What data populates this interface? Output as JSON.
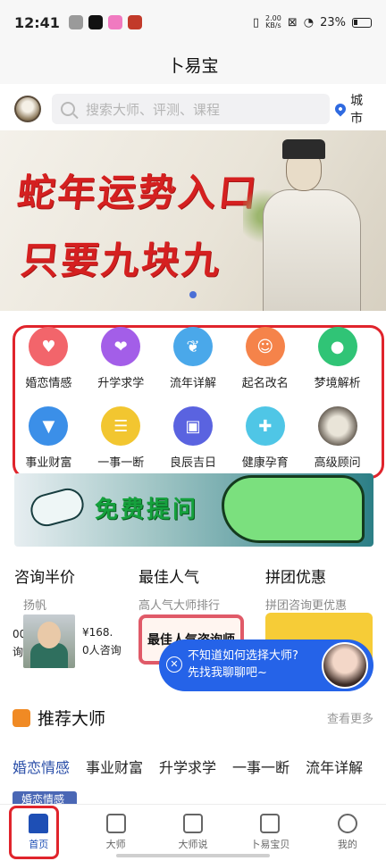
{
  "status": {
    "time": "12:41",
    "speed_top": "2.00",
    "speed_bottom": "KB/s",
    "battery": "23%"
  },
  "app_title": "卜易宝",
  "search": {
    "placeholder": "搜索大师、评测、课程",
    "city": "城市"
  },
  "banner": {
    "line1": "蛇年运势入口",
    "line2": "只要九块九"
  },
  "categories": [
    {
      "label": "婚恋情感",
      "icon": "couple-icon",
      "color": "#f2656b"
    },
    {
      "label": "升学求学",
      "icon": "heart-book-icon",
      "color": "#a35ee8"
    },
    {
      "label": "流年详解",
      "icon": "leaf-icon",
      "color": "#4aa8ea"
    },
    {
      "label": "起名改名",
      "icon": "family-icon",
      "color": "#f5834a"
    },
    {
      "label": "梦境解析",
      "icon": "person-icon",
      "color": "#30c476"
    },
    {
      "label": "事业财富",
      "icon": "tie-icon",
      "color": "#3b8fe8"
    },
    {
      "label": "一事一断",
      "icon": "chat-icon",
      "color": "#f2c630"
    },
    {
      "label": "良辰吉日",
      "icon": "calendar-icon",
      "color": "#5a63e0"
    },
    {
      "label": "健康孕育",
      "icon": "health-heart-icon",
      "color": "#4fc6e6"
    },
    {
      "label": "高级顾问",
      "icon": "advisor-avatar-icon",
      "color": "#8e8679"
    }
  ],
  "free_ask": {
    "text": "免费提问"
  },
  "sections": {
    "consult": {
      "title": "咨询半价",
      "sub": "扬帆",
      "left_fragment": "00",
      "left_fragment2": "询",
      "price": "¥168.",
      "count": "0人咨询"
    },
    "popular": {
      "title": "最佳人气",
      "sub": "高人气大师排行",
      "badge": "最佳人气咨询师"
    },
    "group": {
      "title": "拼团优惠",
      "sub": "拼团咨询更优惠",
      "badge": "拼团更优惠"
    }
  },
  "chat_bubble": {
    "line1": "不知道如何选择大师?",
    "line2": "先找我聊聊吧~"
  },
  "recommend": {
    "title": "推荐大师",
    "more": "查看更多",
    "tabs": [
      "婚恋情感",
      "事业财富",
      "升学求学",
      "一事一断",
      "流年详解"
    ],
    "chip": "婚恋情感"
  },
  "nav": [
    {
      "label": "首页",
      "icon": "home-icon"
    },
    {
      "label": "大师",
      "icon": "scroll-icon"
    },
    {
      "label": "大师说",
      "icon": "graduation-cap-icon"
    },
    {
      "label": "卜易宝贝",
      "icon": "bag-icon"
    },
    {
      "label": "我的",
      "icon": "user-icon"
    }
  ]
}
